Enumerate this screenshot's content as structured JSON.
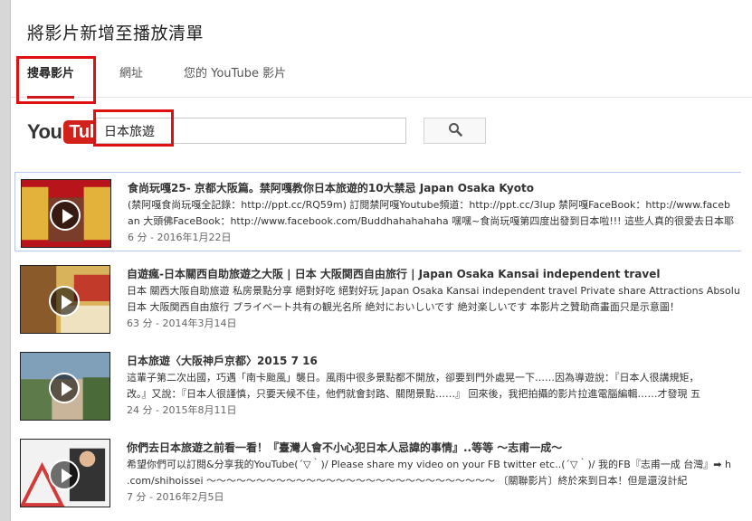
{
  "dialog": {
    "title": "將影片新增至播放清單"
  },
  "tabs": [
    {
      "label": "搜尋影片",
      "active": true
    },
    {
      "label": "網址",
      "active": false
    },
    {
      "label": "您的 YouTube 影片",
      "active": false
    }
  ],
  "logo": {
    "you": "You",
    "tube": "Tube"
  },
  "search": {
    "value": "日本旅遊",
    "button_icon": "search-icon"
  },
  "results": [
    {
      "title": "食尚玩嘎25- 京都大阪篇。禁阿嘎教你日本旅遊的10大禁忌 Japan Osaka Kyoto",
      "desc1": "(禁阿嘎食尚玩嘎全記錄：http://ppt.cc/RQ59m) 訂閱禁阿嘎Youtube頻道：http://ppt.cc/3lup 禁阿嘎FaceBook：http://www.faceb",
      "desc2": "an 大頭佛FaceBook：http://www.facebook.com/Buddhahahahaha 嘿嘿~食尚玩嘎第四度出發到日本啦!!! 這些人真的很愛去日本耶",
      "meta": "6 分 - 2016年1月22日",
      "thumb_colors": [
        "#b8141c",
        "#e2b23a"
      ]
    },
    {
      "title": "自遊瘋-日本關西自助旅遊之大阪 | 日本 大阪関西自由旅行 | Japan Osaka Kansai independent travel",
      "desc1": "日本 關西大阪自助旅遊 私房景點分享 絕對好吃 絕對好玩 Japan Osaka Kansai independent travel Private share Attractions Absolu",
      "desc2": "日本 大阪関西自由旅行 プライベート共有の観光名所 絶対においしいです 絶対楽しいです 本影片之贊助商畫面只是示意圖！",
      "meta": "63 分 - 2014年3月14日",
      "thumb_colors": [
        "#8a5a2a",
        "#d9b25c"
      ]
    },
    {
      "title": "日本旅遊〈大阪神戶京都〉2015 7 16",
      "desc1": "這輩子第二次出國，巧遇「南卡颱風」襲日。風雨中很多景點都不開放，卻要到門外處晃一下……因為導遊說：『日本人很講規矩，",
      "desc2": "改。』又說：『日本人很謹慎，只要天候不佳，他們就會封路、關閉景點……』 回來後，我把拍攝的影片拉進電腦編輯……才發現 五",
      "meta": "24 分 - 2015年8月11日",
      "thumb_colors": [
        "#5d7a4a",
        "#c9b59a"
      ]
    },
    {
      "title": "你們去日本旅遊之前看一看！『臺灣人會不小心犯日本人忌諱的事情』..等等 ～志甫一成～",
      "desc1": "希望你們可以訂閱&分享我的YouTube(´▽｀)/ Please share my video on your FB twitter etc..(´▽｀)/ 我的FB『志甫一成 台灣』➡ h",
      "desc2": ".com/shihoissei 〜〜〜〜〜〜〜〜〜〜〜〜〜〜〜〜〜〜〜〜〜〜〜〜〜〜〜〜〜 〔關聯影片〕終於來到日本！但是還沒計紀",
      "meta": "7 分 - 2016年2月5日",
      "thumb_colors": [
        "#f2f2f2",
        "#d43a3a"
      ]
    }
  ]
}
